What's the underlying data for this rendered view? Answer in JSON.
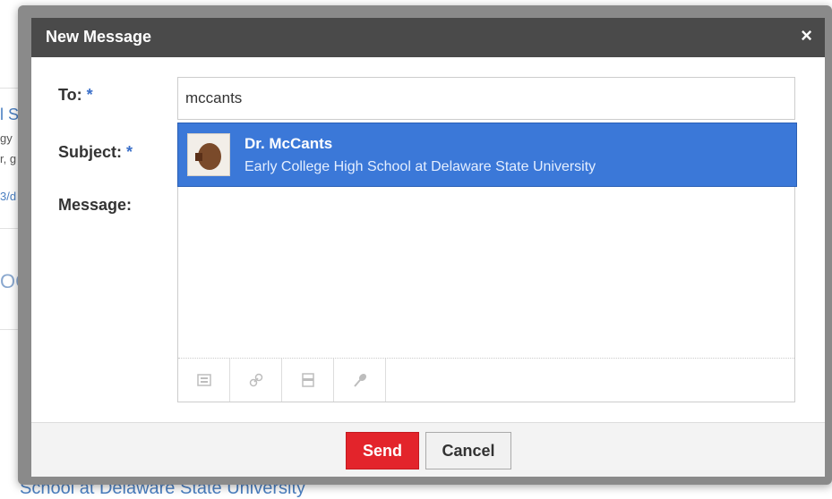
{
  "dialog": {
    "title": "New Message",
    "close_icon": "×"
  },
  "form": {
    "to_label": "To:",
    "subject_label": "Subject:",
    "message_label": "Message:",
    "required_marker": "*",
    "to_value": "mccants"
  },
  "suggestion": {
    "name": "Dr. McCants",
    "organization": "Early College High School at Delaware State University"
  },
  "toolbar": {
    "icons": [
      "image-icon",
      "link-icon",
      "embed-icon",
      "record-icon"
    ]
  },
  "footer": {
    "send_label": "Send",
    "cancel_label": "Cancel"
  },
  "background": {
    "frag_1": "l S",
    "frag_2": "gy",
    "frag_3": "r, g",
    "frag_4": "3/d",
    "frag_5": "OG",
    "frag_6": "School at Delaware State University"
  },
  "colors": {
    "titlebar": "#4a4a4a",
    "suggestion_bg": "#3b78d8",
    "send_bg": "#e3242b",
    "required": "#3a6fc9"
  }
}
